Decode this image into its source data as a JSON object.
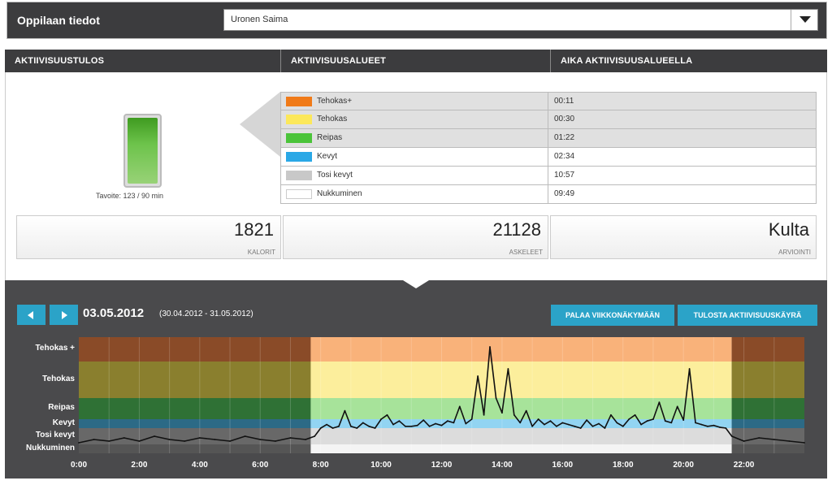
{
  "header": {
    "title": "Oppilaan tiedot",
    "student": "Uronen Saima"
  },
  "sections": {
    "result": "AKTIIVISUUSTULOS",
    "zones": "AKTIIVISUUSALUEET",
    "time": "AIKA AKTIIVISUUSALUEELLA"
  },
  "goal": {
    "text": "Tavoite: 123 / 90 min",
    "current_min": 123,
    "target_min": 90
  },
  "zones": [
    {
      "name": "Tehokas+",
      "time": "00:11",
      "color": "#f07a18"
    },
    {
      "name": "Tehokas",
      "time": "00:30",
      "color": "#fce85a"
    },
    {
      "name": "Reipas",
      "time": "01:22",
      "color": "#4bc43a"
    },
    {
      "name": "Kevyt",
      "time": "02:34",
      "color": "#2aa8e6"
    },
    {
      "name": "Tosi kevyt",
      "time": "10:57",
      "color": "#c8c8c8"
    },
    {
      "name": "Nukkuminen",
      "time": "09:49",
      "color": "#ffffff"
    }
  ],
  "stats": {
    "calories": {
      "value": "1821",
      "label": "KALORIT"
    },
    "steps": {
      "value": "21128",
      "label": "ASKELEET"
    },
    "rating": {
      "value": "Kulta",
      "label": "ARVIOINTI"
    }
  },
  "chart": {
    "date": "03.05.2012",
    "range": "(30.04.2012 - 31.05.2012)",
    "week_view_label": "PALAA VIIKKONÄKYMÄÄN",
    "print_label": "TULOSTA AKTIIVISUUSKÄYRÄ",
    "y_labels": [
      "Tehokas +",
      "Tehokas",
      "Reipas",
      "Kevyt",
      "Tosi kevyt",
      "Nukkuminen"
    ],
    "x_labels": [
      "0:00",
      "2:00",
      "4:00",
      "6:00",
      "8:00",
      "10:00",
      "12:00",
      "14:00",
      "16:00",
      "18:00",
      "20:00",
      "22:00"
    ],
    "awake_range_h": [
      7.67,
      21.6
    ]
  },
  "chart_data": {
    "type": "line",
    "x_unit": "hour",
    "xlim": [
      0,
      24
    ],
    "y_levels": [
      "Nukkuminen",
      "Tosi kevyt",
      "Kevyt",
      "Reipas",
      "Tehokas",
      "Tehokas +"
    ],
    "series": [
      {
        "name": "",
        "x": [
          0,
          0.5,
          1,
          1.5,
          2,
          2.5,
          3,
          3.5,
          4,
          4.5,
          5,
          5.5,
          6,
          6.5,
          7,
          7.5,
          7.8,
          8.0,
          8.2,
          8.4,
          8.6,
          8.8,
          9.0,
          9.2,
          9.4,
          9.6,
          9.8,
          10.0,
          10.2,
          10.4,
          10.6,
          10.8,
          11.0,
          11.2,
          11.4,
          11.6,
          11.8,
          12.0,
          12.2,
          12.4,
          12.6,
          12.8,
          13.0,
          13.2,
          13.4,
          13.6,
          13.8,
          14.0,
          14.2,
          14.4,
          14.6,
          14.8,
          15.0,
          15.2,
          15.4,
          15.6,
          15.8,
          16.0,
          16.2,
          16.4,
          16.6,
          16.8,
          17.0,
          17.2,
          17.4,
          17.6,
          17.8,
          18.0,
          18.2,
          18.4,
          18.6,
          18.8,
          19.0,
          19.2,
          19.4,
          19.6,
          19.8,
          20.0,
          20.2,
          20.4,
          20.6,
          20.8,
          21.0,
          21.2,
          21.4,
          21.6,
          22,
          22.5,
          23,
          23.5,
          24
        ],
        "y": [
          1.1,
          1.3,
          1.2,
          1.4,
          1.2,
          1.5,
          1.3,
          1.2,
          1.4,
          1.3,
          1.2,
          1.5,
          1.3,
          1.2,
          1.4,
          1.3,
          1.5,
          2.0,
          2.4,
          2.0,
          2.2,
          3.4,
          2.2,
          2.0,
          2.6,
          2.2,
          2.0,
          3.0,
          3.2,
          2.4,
          2.8,
          2.2,
          2.2,
          2.3,
          2.9,
          2.2,
          2.5,
          2.3,
          2.8,
          2.6,
          3.6,
          2.5,
          3.0,
          4.6,
          3.2,
          5.6,
          4.0,
          3.3,
          4.8,
          3.2,
          2.6,
          3.4,
          2.2,
          3.0,
          2.4,
          2.8,
          2.2,
          2.6,
          2.4,
          2.2,
          2.0,
          2.9,
          2.2,
          2.5,
          2.0,
          3.2,
          2.6,
          2.2,
          3.0,
          3.2,
          2.4,
          2.8,
          3.0,
          3.8,
          2.8,
          2.6,
          3.6,
          2.9,
          4.8,
          2.6,
          2.4,
          2.2,
          2.3,
          2.1,
          2.0,
          1.5,
          1.2,
          1.4,
          1.3,
          1.2,
          1.1
        ]
      }
    ]
  }
}
